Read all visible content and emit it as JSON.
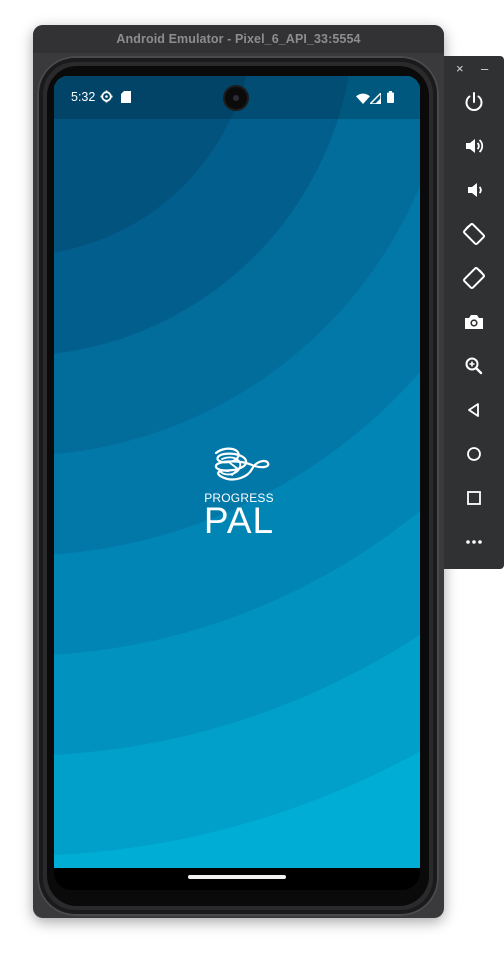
{
  "window": {
    "title": "Android Emulator - Pixel_6_API_33:5554"
  },
  "status_bar": {
    "time": "5:32",
    "left_icons": [
      "settings-gear-icon",
      "sd-card-icon"
    ],
    "right_icons": [
      "wifi-icon",
      "cellular-signal-icon",
      "battery-icon"
    ]
  },
  "app": {
    "logo_small": "PROGRESS",
    "logo_big": "PAL"
  },
  "toolbar": {
    "close_label": "×",
    "minimize_label": "–",
    "buttons": [
      {
        "name": "power-icon"
      },
      {
        "name": "volume-up-icon"
      },
      {
        "name": "volume-down-icon"
      },
      {
        "name": "rotate-left-icon"
      },
      {
        "name": "rotate-right-icon"
      },
      {
        "name": "camera-icon"
      },
      {
        "name": "zoom-icon"
      },
      {
        "name": "back-icon"
      },
      {
        "name": "home-icon"
      },
      {
        "name": "overview-icon"
      },
      {
        "name": "more-icon"
      }
    ]
  },
  "colors": {
    "wallpaper_dark": "#02507a",
    "wallpaper_light": "#00b3da",
    "toolbar_bg": "#2f3133"
  }
}
